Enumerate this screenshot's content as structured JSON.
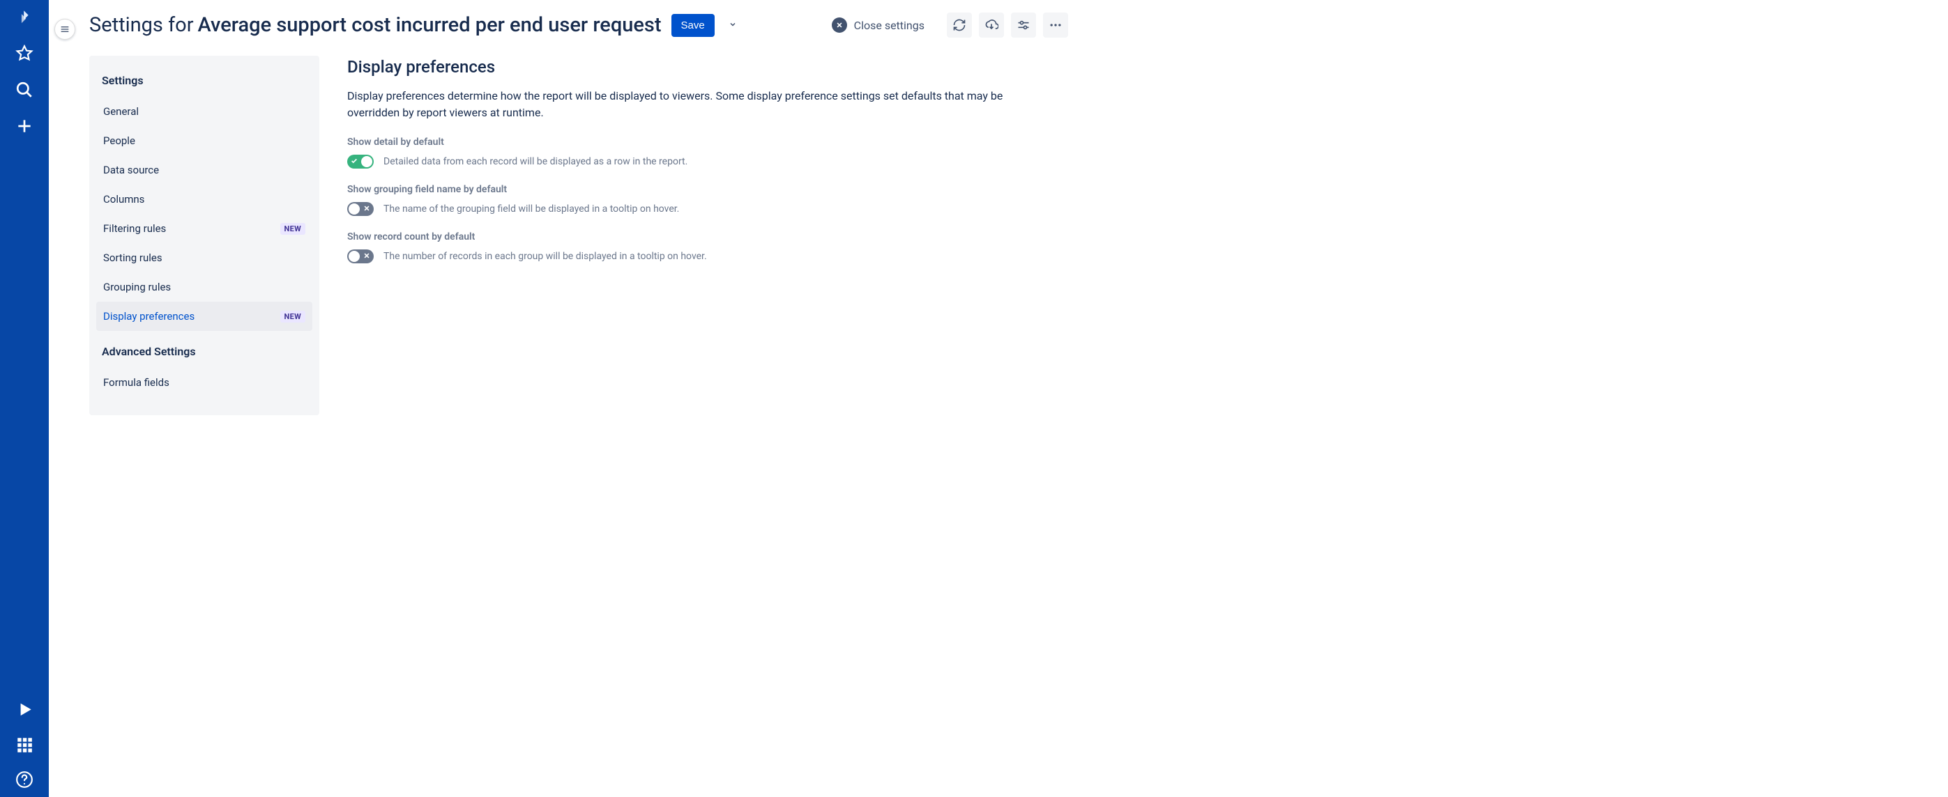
{
  "header": {
    "title_prefix": "Settings for",
    "title_name": "Average support cost incurred per end user request",
    "save_label": "Save",
    "close_label": "Close settings"
  },
  "sidebar": {
    "heading1": "Settings",
    "heading2": "Advanced Settings",
    "items": [
      {
        "label": "General",
        "badge": "",
        "active": false
      },
      {
        "label": "People",
        "badge": "",
        "active": false
      },
      {
        "label": "Data source",
        "badge": "",
        "active": false
      },
      {
        "label": "Columns",
        "badge": "",
        "active": false
      },
      {
        "label": "Filtering rules",
        "badge": "NEW",
        "active": false
      },
      {
        "label": "Sorting rules",
        "badge": "",
        "active": false
      },
      {
        "label": "Grouping rules",
        "badge": "",
        "active": false
      },
      {
        "label": "Display preferences",
        "badge": "NEW",
        "active": true
      }
    ],
    "advanced_items": [
      {
        "label": "Formula fields"
      }
    ]
  },
  "content": {
    "title": "Display preferences",
    "description": "Display preferences determine how the report will be displayed to viewers. Some display preference settings set defaults that may be overridden by report viewers at runtime.",
    "prefs": [
      {
        "label": "Show detail by default",
        "on": true,
        "desc": "Detailed data from each record will be displayed as a row in the report."
      },
      {
        "label": "Show grouping field name by default",
        "on": false,
        "desc": "The name of the grouping field will be displayed in a tooltip on hover."
      },
      {
        "label": "Show record count by default",
        "on": false,
        "desc": "The number of records in each group will be displayed in a tooltip on hover."
      }
    ]
  }
}
